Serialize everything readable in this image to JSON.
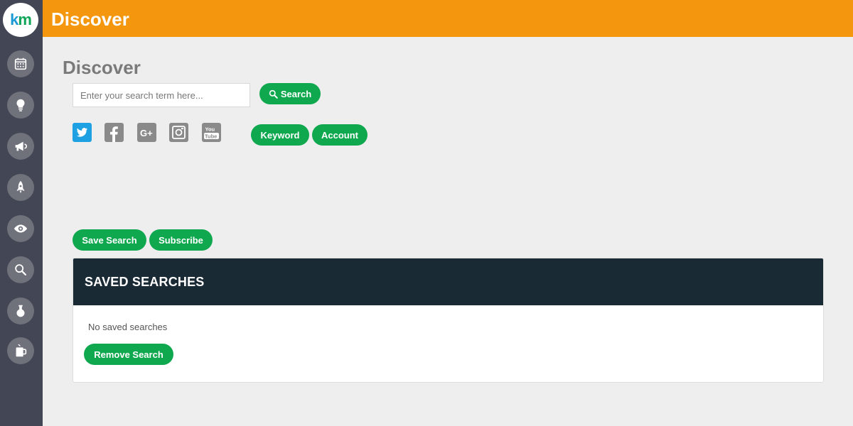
{
  "logo": {
    "k": "k",
    "m": "m"
  },
  "sidebar": {
    "items": [
      {
        "name": "calendar"
      },
      {
        "name": "lightbulb"
      },
      {
        "name": "megaphone"
      },
      {
        "name": "rocket"
      },
      {
        "name": "eye"
      },
      {
        "name": "search"
      },
      {
        "name": "flask"
      },
      {
        "name": "mug"
      }
    ]
  },
  "header": {
    "title": "Discover"
  },
  "main": {
    "title": "Discover",
    "search": {
      "placeholder": "Enter your search term here...",
      "value": "",
      "button_label": "Search"
    },
    "social": [
      "twitter",
      "facebook",
      "google-plus",
      "instagram",
      "youtube"
    ],
    "filters": {
      "keyword_label": "Keyword",
      "account_label": "Account"
    },
    "actions": {
      "save_label": "Save Search",
      "subscribe_label": "Subscribe"
    },
    "saved_searches": {
      "title": "SAVED SEARCHES",
      "empty_message": "No saved searches",
      "remove_label": "Remove Search"
    }
  },
  "colors": {
    "accent": "#f4960e",
    "sidebar": "#434654",
    "button": "#0fa84f",
    "panel_head": "#192a35",
    "twitter": "#1da1e2"
  }
}
